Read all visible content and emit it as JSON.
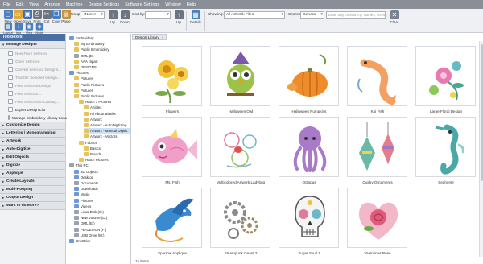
{
  "menu": [
    "File",
    "Edit",
    "View",
    "Arrange",
    "Machine",
    "Design Settings",
    "Software Settings",
    "Window",
    "Help"
  ],
  "toolbar": {
    "buttons": [
      {
        "label": "New",
        "icon": "new-file-icon",
        "color": "#4a7fc1"
      },
      {
        "label": "Open",
        "icon": "open-folder-icon",
        "color": "#e0a73a"
      },
      {
        "label": "Save",
        "icon": "save-icon",
        "color": "#3f6fb0"
      },
      {
        "label": "Print",
        "icon": "print-icon",
        "color": "#6b7480"
      },
      {
        "label": "Cut",
        "icon": "cut-icon",
        "color": "#6b7480"
      },
      {
        "label": "Copy",
        "icon": "copy-icon",
        "color": "#4a7fc1"
      },
      {
        "label": "Paste",
        "icon": "paste-icon",
        "color": "#c8923a"
      }
    ],
    "view_buttons": [
      {
        "label": "Layout",
        "icon": "layout-icon",
        "color": "#4a7fc1"
      },
      {
        "label": "Info",
        "icon": "info-icon",
        "color": "#4a7fc1"
      },
      {
        "label": "View",
        "icon": "view-icon",
        "color": "#4a7fc1"
      },
      {
        "label": "Node",
        "icon": "node-icon",
        "color": "#4a7fc1"
      }
    ],
    "group_by_label": "Group by:",
    "group_by_value": "<None>",
    "up_label": "Up",
    "down_label": "Down",
    "sort_by_label": "Sort by:",
    "sort_up_label": "Up",
    "details_label": "Details",
    "showing_label": "Showing:",
    "showing_value": "All Artwork Files",
    "search_label": "Search:",
    "search_value": "General",
    "search_placeholder": "Enter any criteria e.g. names, sizes, <, >, =",
    "clear_label": "Clear"
  },
  "docker": {
    "title": "Toolboxes",
    "manage_designs": {
      "label": "Manage Designs",
      "items": [
        {
          "label": "New From Selected",
          "dim": true
        },
        {
          "label": "Open Selected",
          "dim": true
        },
        {
          "label": "Convert Selected Designs...",
          "dim": true
        },
        {
          "label": "Transfer Selected Design...",
          "dim": true
        },
        {
          "label": "Print Selected Design",
          "dim": true
        },
        {
          "label": "Print Selection...",
          "dim": true
        },
        {
          "label": "Print Selected to Catalog...",
          "dim": true
        },
        {
          "label": "Export Design List",
          "dim": false
        },
        {
          "label": "Manage Embroidery Library Loca...",
          "dim": false
        }
      ]
    },
    "sections": [
      "Customize Design",
      "Lettering / Monogramming",
      "Artwork",
      "Auto-Digitize",
      "Edit Objects",
      "Digitize",
      "Appliqué",
      "Create Layouts",
      "Multi-Hooping",
      "Output Design",
      "Want to do More?"
    ]
  },
  "tree": [
    {
      "label": "Embroidery",
      "indent": 0,
      "kind": "blue"
    },
    {
      "label": "My Embroidery",
      "indent": 1,
      "kind": "yellow"
    },
    {
      "label": "Public Embroidery",
      "indent": 1,
      "kind": "yellow"
    },
    {
      "label": "OML (E)",
      "indent": 1,
      "kind": "gray"
    },
    {
      "label": "AAA clipart",
      "indent": 1,
      "kind": "yellow"
    },
    {
      "label": "DESIGNS",
      "indent": 1,
      "kind": "yellow"
    },
    {
      "label": "Pictures",
      "indent": 0,
      "kind": "blue"
    },
    {
      "label": "Pictures",
      "indent": 1,
      "kind": "yellow"
    },
    {
      "label": "Public Pictures",
      "indent": 1,
      "kind": "yellow"
    },
    {
      "label": "Pictures",
      "indent": 1,
      "kind": "yellow"
    },
    {
      "label": "Public Pictures",
      "indent": 1,
      "kind": "yellow"
    },
    {
      "label": "Hatch 1 Pictures",
      "indent": 2,
      "kind": "yellow"
    },
    {
      "label": "Articles",
      "indent": 3,
      "kind": "yellow"
    },
    {
      "label": "All About Blanks",
      "indent": 3,
      "kind": "yellow"
    },
    {
      "label": "Artwork",
      "indent": 3,
      "kind": "yellow"
    },
    {
      "label": "Artwork - AutoDigitizing",
      "indent": 3,
      "kind": "yellow"
    },
    {
      "label": "Artwork - Manual Digitis",
      "indent": 3,
      "kind": "yellow",
      "selected": true
    },
    {
      "label": "Artwork - Vectors",
      "indent": 3,
      "kind": "yellow"
    },
    {
      "label": "Fabrics",
      "indent": 2,
      "kind": "yellow"
    },
    {
      "label": "Basics",
      "indent": 3,
      "kind": "yellow"
    },
    {
      "label": "Breads",
      "indent": 3,
      "kind": "yellow"
    },
    {
      "label": "Hatch Pictures",
      "indent": 2,
      "kind": "yellow"
    },
    {
      "label": "This PC",
      "indent": 0,
      "kind": "gray"
    },
    {
      "label": "3D Objects",
      "indent": 1,
      "kind": "blue"
    },
    {
      "label": "Desktop",
      "indent": 1,
      "kind": "blue"
    },
    {
      "label": "Documents",
      "indent": 1,
      "kind": "gray"
    },
    {
      "label": "Downloads",
      "indent": 1,
      "kind": "blue"
    },
    {
      "label": "Music",
      "indent": 1,
      "kind": "blue"
    },
    {
      "label": "Pictures",
      "indent": 1,
      "kind": "blue"
    },
    {
      "label": "Videos",
      "indent": 1,
      "kind": "blue"
    },
    {
      "label": "Local Disk (C:)",
      "indent": 1,
      "kind": "gray"
    },
    {
      "label": "New Volume (D:)",
      "indent": 1,
      "kind": "gray"
    },
    {
      "label": "OML (E:)",
      "indent": 1,
      "kind": "gray"
    },
    {
      "label": "PE-DESIGN (F:)",
      "indent": 1,
      "kind": "gray"
    },
    {
      "label": "USB Drive (M:)",
      "indent": 1,
      "kind": "gray"
    },
    {
      "label": "OneDrive",
      "indent": 0,
      "kind": "blue"
    }
  ],
  "gallery": {
    "tab_label": "Design Library",
    "items": [
      {
        "label": "Flowers",
        "art": "flowers"
      },
      {
        "label": "Halloween Owl",
        "art": "owl"
      },
      {
        "label": "Halloween Pumpkins",
        "art": "pumpkins"
      },
      {
        "label": "Koi Fish",
        "art": "koi"
      },
      {
        "label": "Large Floral Design",
        "art": "floral"
      },
      {
        "label": "Ms. Fish",
        "art": "msfish"
      },
      {
        "label": "Multicolored Artwork Ladybug",
        "art": "ladybug"
      },
      {
        "label": "Octopus",
        "art": "octopus"
      },
      {
        "label": "Quirky Ornaments",
        "art": "ornaments"
      },
      {
        "label": "Seahorse",
        "art": "seahorse"
      },
      {
        "label": "Sparrow Applique",
        "art": "sparrow"
      },
      {
        "label": "Steampunk Gears 2",
        "art": "gears"
      },
      {
        "label": "Sugar Skull 1",
        "art": "skull"
      },
      {
        "label": "Valentines Rose",
        "art": "rose"
      }
    ],
    "count": "15 items"
  }
}
